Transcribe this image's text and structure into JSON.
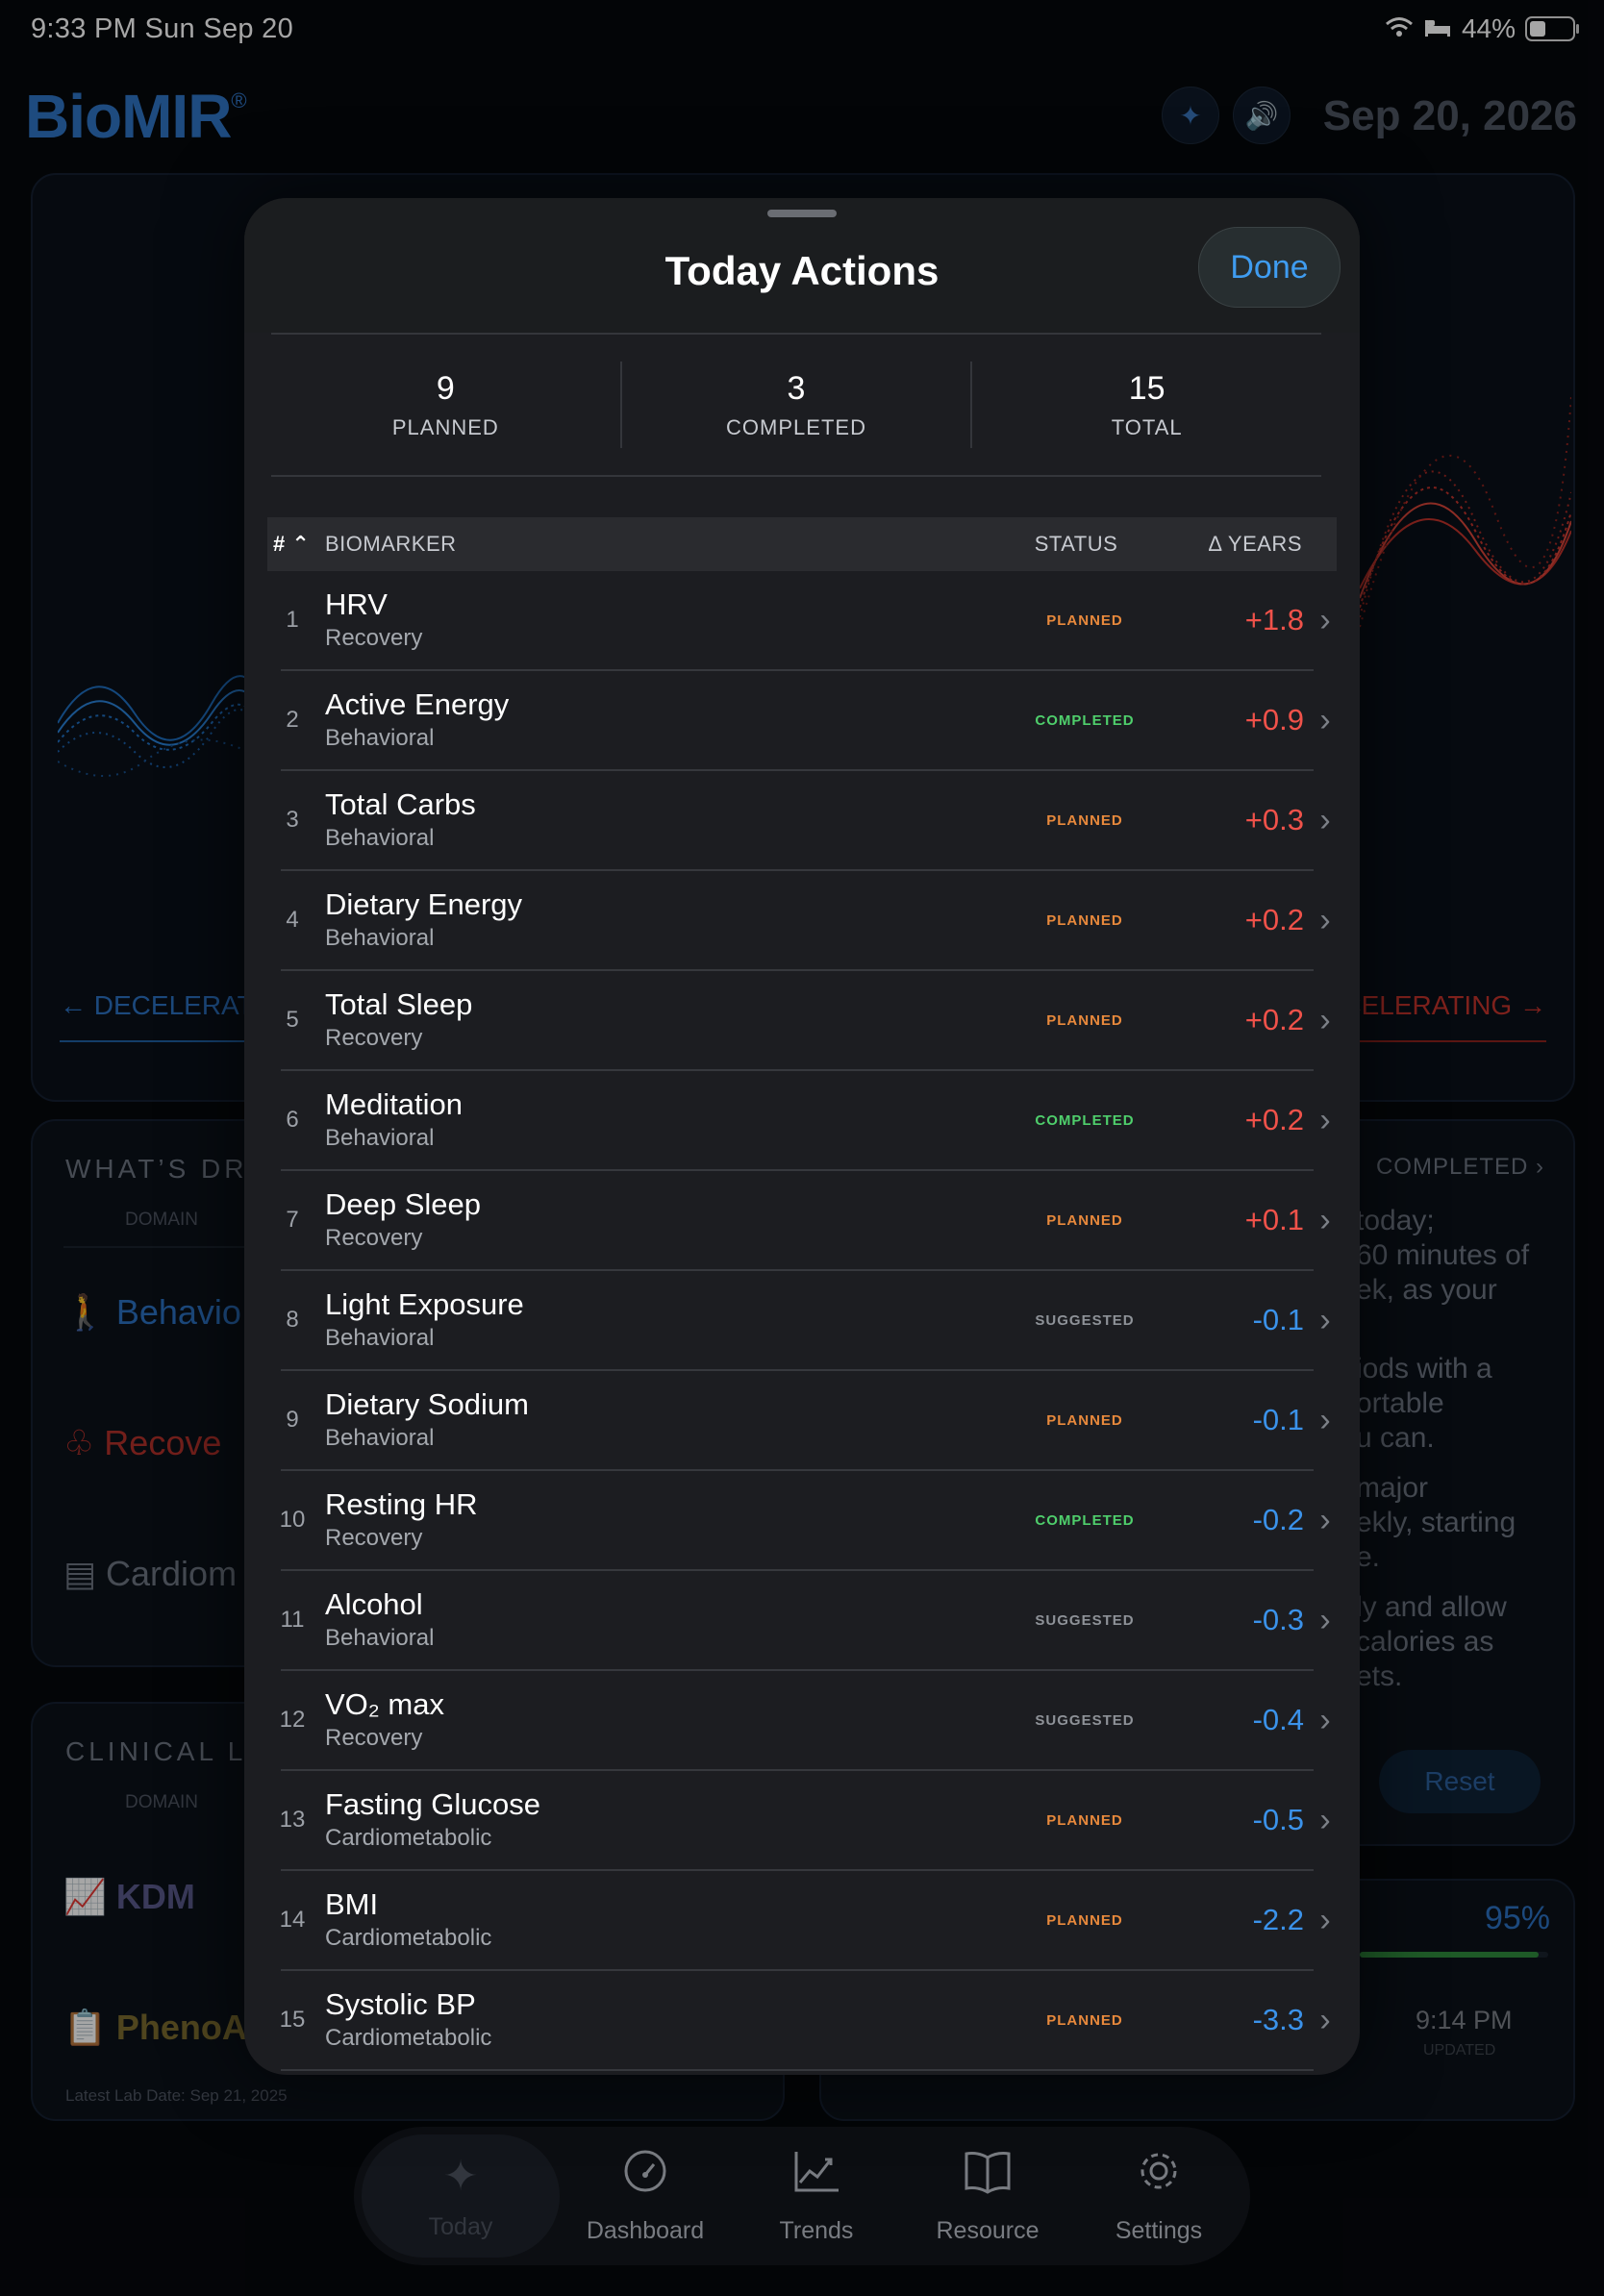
{
  "status_bar": {
    "time_day": "9:33 PM  Sun Sep 20",
    "battery": "44%"
  },
  "app": {
    "logo": "BioMIR",
    "logo_mark": "®",
    "date": "Sep 20, 2026",
    "decel_label": "DECELERAT",
    "accel_label": "CELERATING",
    "drivers_title": "WHAT’S DR",
    "domain_label": "DOMAIN",
    "drivers": [
      "Behavio",
      "Recove",
      "Cardiom"
    ],
    "completed_link": "COMPLETED",
    "tips": [
      "today;",
      "60 minutes of",
      "ek, as your",
      "iods with a",
      "ortable",
      "u can.",
      "major",
      "ekly, starting",
      "e.",
      "ly and allow",
      "calories as",
      "ets."
    ],
    "reset_label": "Reset",
    "clinical_title": "CLINICAL L",
    "clinical_domain_label": "DOMAIN",
    "clinical": [
      "KDM",
      "PhenoA"
    ],
    "latest_lab": "Latest Lab Date: Sep 21, 2025",
    "progress_pct": "95%",
    "progress_fraction": 0.95,
    "updated_time": "9:14 PM",
    "updated_label": "UPDATED"
  },
  "tabs": [
    {
      "label": "Today",
      "icon": "sparkle-icon"
    },
    {
      "label": "Dashboard",
      "icon": "gauge-icon"
    },
    {
      "label": "Trends",
      "icon": "trend-chart-icon"
    },
    {
      "label": "Resource",
      "icon": "book-icon"
    },
    {
      "label": "Settings",
      "icon": "gear-icon"
    }
  ],
  "sheet": {
    "title": "Today Actions",
    "done_label": "Done",
    "summary": [
      {
        "value": "9",
        "label": "PLANNED"
      },
      {
        "value": "3",
        "label": "COMPLETED"
      },
      {
        "value": "15",
        "label": "TOTAL"
      }
    ],
    "columns": {
      "num": "#",
      "biomarker": "BIOMARKER",
      "status": "STATUS",
      "years": "Δ YEARS"
    },
    "rows": [
      {
        "idx": "1",
        "name": "HRV",
        "category": "Recovery",
        "status": "PLANNED",
        "delta": "+1.8"
      },
      {
        "idx": "2",
        "name": "Active Energy",
        "category": "Behavioral",
        "status": "COMPLETED",
        "delta": "+0.9"
      },
      {
        "idx": "3",
        "name": "Total Carbs",
        "category": "Behavioral",
        "status": "PLANNED",
        "delta": "+0.3"
      },
      {
        "idx": "4",
        "name": "Dietary Energy",
        "category": "Behavioral",
        "status": "PLANNED",
        "delta": "+0.2"
      },
      {
        "idx": "5",
        "name": "Total Sleep",
        "category": "Recovery",
        "status": "PLANNED",
        "delta": "+0.2"
      },
      {
        "idx": "6",
        "name": "Meditation",
        "category": "Behavioral",
        "status": "COMPLETED",
        "delta": "+0.2"
      },
      {
        "idx": "7",
        "name": "Deep Sleep",
        "category": "Recovery",
        "status": "PLANNED",
        "delta": "+0.1"
      },
      {
        "idx": "8",
        "name": "Light Exposure",
        "category": "Behavioral",
        "status": "SUGGESTED",
        "delta": "-0.1"
      },
      {
        "idx": "9",
        "name": "Dietary Sodium",
        "category": "Behavioral",
        "status": "PLANNED",
        "delta": "-0.1"
      },
      {
        "idx": "10",
        "name": "Resting HR",
        "category": "Recovery",
        "status": "COMPLETED",
        "delta": "-0.2"
      },
      {
        "idx": "11",
        "name": "Alcohol",
        "category": "Behavioral",
        "status": "SUGGESTED",
        "delta": "-0.3"
      },
      {
        "idx": "12",
        "name": "VO₂ max",
        "category": "Recovery",
        "status": "SUGGESTED",
        "delta": "-0.4"
      },
      {
        "idx": "13",
        "name": "Fasting Glucose",
        "category": "Cardiometabolic",
        "status": "PLANNED",
        "delta": "-0.5"
      },
      {
        "idx": "14",
        "name": "BMI",
        "category": "Cardiometabolic",
        "status": "PLANNED",
        "delta": "-2.2"
      },
      {
        "idx": "15",
        "name": "Systolic BP",
        "category": "Cardiometabolic",
        "status": "PLANNED",
        "delta": "-3.3"
      }
    ]
  },
  "colors": {
    "positive": "#f0524a",
    "negative": "#3b92ea",
    "planned": "#e8893c",
    "completed": "#4fcf6c",
    "suggested": "#8e9298",
    "accent": "#3f9cf0"
  }
}
